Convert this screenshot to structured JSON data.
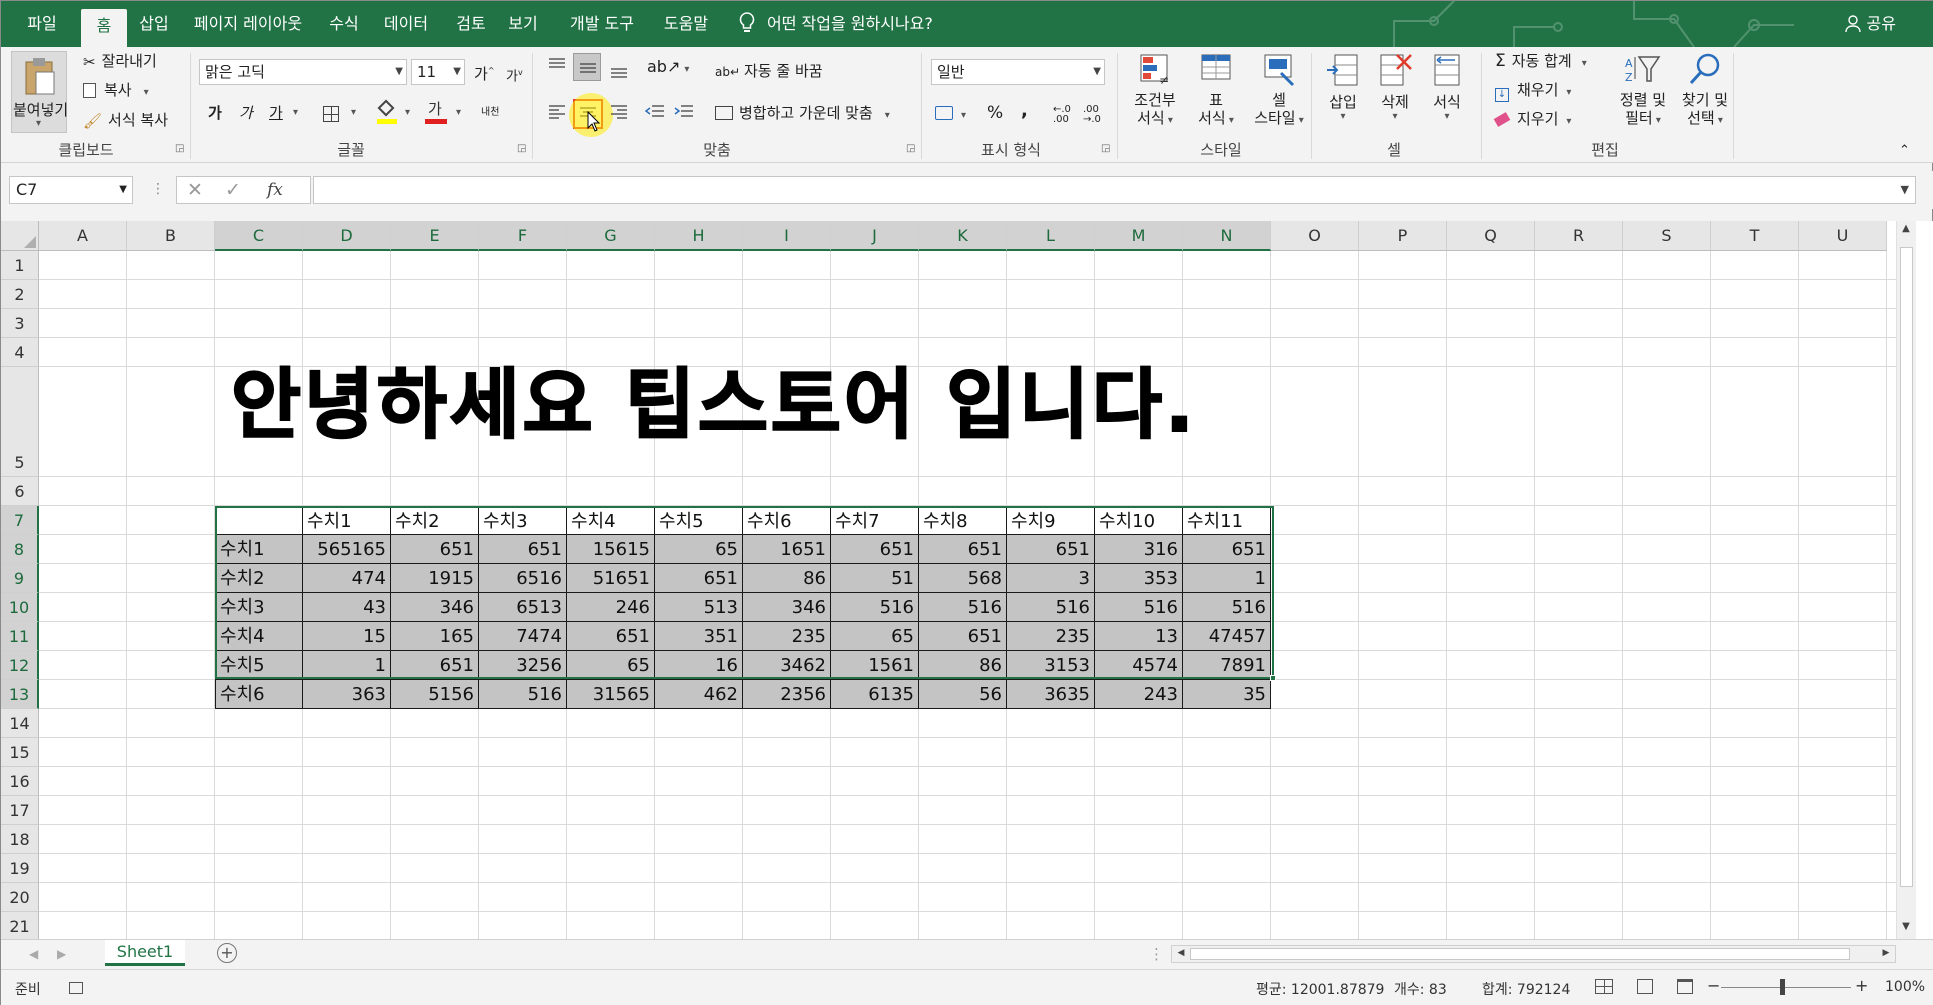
{
  "tabs": [
    {
      "label": "파일"
    },
    {
      "label": "홈"
    },
    {
      "label": "삽입"
    },
    {
      "label": "페이지 레이아웃"
    },
    {
      "label": "수식"
    },
    {
      "label": "데이터"
    },
    {
      "label": "검토"
    },
    {
      "label": "보기"
    },
    {
      "label": "개발 도구"
    },
    {
      "label": "도움말"
    }
  ],
  "active_tab": "홈",
  "tell_me": "어떤 작업을 원하시나요?",
  "share": "공유",
  "ribbon": {
    "clipboard": {
      "paste": "붙여넣기",
      "cut": "잘라내기",
      "copy": "복사",
      "format_painter": "서식 복사",
      "label": "클립보드"
    },
    "font": {
      "name": "맑은 고딕",
      "size": "11",
      "label": "글꼴",
      "bold": "가",
      "italic": "가",
      "underline": "가",
      "grow": "가",
      "shrink": "가",
      "color_letter": "가",
      "phonetic": "내천"
    },
    "alignment": {
      "wrap": "자동 줄 바꿈",
      "merge": "병합하고 가운데 맞춤",
      "label": "맞춤"
    },
    "number": {
      "format": "일반",
      "percent": "%",
      "comma": ",",
      "label": "표시 형식"
    },
    "styles": {
      "conditional_1": "조건부",
      "conditional_2": "서식",
      "table_1": "표",
      "table_2": "서식",
      "cell_1": "셀",
      "cell_2": "스타일",
      "label": "스타일"
    },
    "cells": {
      "insert": "삽입",
      "delete": "삭제",
      "format": "서식",
      "label": "셀"
    },
    "editing": {
      "autosum": "자동 합계",
      "fill": "채우기",
      "clear": "지우기",
      "sort_1": "정렬 및",
      "sort_2": "필터",
      "find_1": "찾기 및",
      "find_2": "선택",
      "label": "편집"
    }
  },
  "name_box": "C7",
  "fx": "fx",
  "columns": [
    "A",
    "B",
    "C",
    "D",
    "E",
    "F",
    "G",
    "H",
    "I",
    "J",
    "K",
    "L",
    "M",
    "N",
    "O",
    "P",
    "Q",
    "R",
    "S",
    "T",
    "U"
  ],
  "rows": [
    "1",
    "2",
    "3",
    "4",
    "5",
    "6",
    "7",
    "8",
    "9",
    "10",
    "11",
    "12",
    "13",
    "14",
    "15",
    "16",
    "17",
    "18",
    "19",
    "20",
    "21"
  ],
  "title_text": "안녕하세요 팁스토어 입니다.",
  "table": {
    "headers": [
      "",
      "수치1",
      "수치2",
      "수치3",
      "수치4",
      "수치5",
      "수치6",
      "수치7",
      "수치8",
      "수치9",
      "수치10",
      "수치11"
    ],
    "rows": [
      [
        "수치1",
        "565165",
        "651",
        "651",
        "15615",
        "65",
        "1651",
        "651",
        "651",
        "651",
        "316",
        "651"
      ],
      [
        "수치2",
        "474",
        "1915",
        "6516",
        "51651",
        "651",
        "86",
        "51",
        "568",
        "3",
        "353",
        "1"
      ],
      [
        "수치3",
        "43",
        "346",
        "6513",
        "246",
        "513",
        "346",
        "516",
        "516",
        "516",
        "516",
        "516"
      ],
      [
        "수치4",
        "15",
        "165",
        "7474",
        "651",
        "351",
        "235",
        "65",
        "651",
        "235",
        "13",
        "47457"
      ],
      [
        "수치5",
        "1",
        "651",
        "3256",
        "65",
        "16",
        "3462",
        "1561",
        "86",
        "3153",
        "4574",
        "7891"
      ],
      [
        "수치6",
        "363",
        "5156",
        "516",
        "31565",
        "462",
        "2356",
        "6135",
        "56",
        "3635",
        "243",
        "35"
      ]
    ]
  },
  "sheet_tab": "Sheet1",
  "status": {
    "ready": "준비",
    "average": "평균: 12001.87879",
    "count": "개수: 83",
    "sum": "합계: 792124",
    "zoom": "100%"
  }
}
